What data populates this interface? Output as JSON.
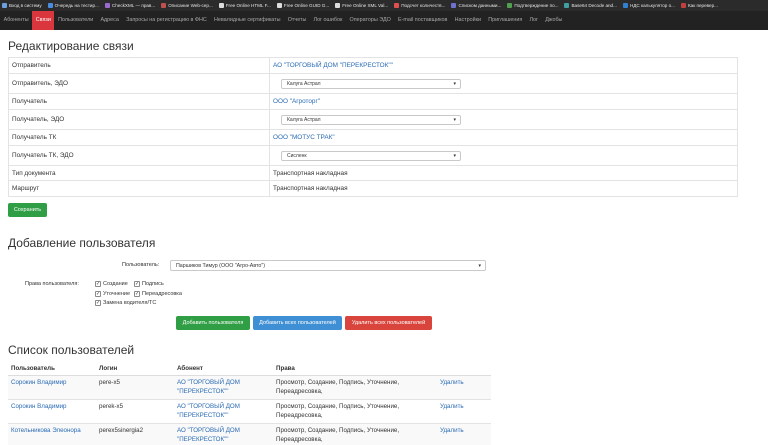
{
  "bookmarks": [
    {
      "label": "Вход в систему",
      "color": "#6aa0e0"
    },
    {
      "label": "Очередь на тестир...",
      "color": "#4a8de0"
    },
    {
      "label": "CheckXML — прав...",
      "color": "#9a6ad0"
    },
    {
      "label": "Описание Web-сер...",
      "color": "#c05050"
    },
    {
      "label": "Free Online HTML F...",
      "color": "#dddddd"
    },
    {
      "label": "Free Online GUID G...",
      "color": "#dddddd"
    },
    {
      "label": "Free Online XML Val...",
      "color": "#dddddd"
    },
    {
      "label": "Подсчет количеств...",
      "color": "#e05050"
    },
    {
      "label": "Списком данными...",
      "color": "#7070d0"
    },
    {
      "label": "Подтверждение по...",
      "color": "#50a050"
    },
    {
      "label": "Base64 Decode and...",
      "color": "#40a0a0"
    },
    {
      "label": "НДС калькулятор о...",
      "color": "#3080d0"
    },
    {
      "label": "Как перевер...",
      "color": "#c04040"
    }
  ],
  "nav": {
    "items": [
      "Абоненты",
      "Связи",
      "Пользователи",
      "Адреса",
      "Запросы на регистрацию в ФНС",
      "Невалидные сертификаты",
      "Отчеты",
      "Лог ошибок",
      "Операторы ЭДО",
      "E-mail поставщиков",
      "Настройки",
      "Приглашения",
      "Лог",
      "Джобы"
    ],
    "active_index": 1
  },
  "edit": {
    "title": "Редактирование связи",
    "rows": [
      {
        "label": "Отправитель",
        "type": "link",
        "value": "АО \"ТОРГОВЫЙ ДОМ \"ПЕРЕКРЕСТОК\"\""
      },
      {
        "label": "Отправитель, ЭДО",
        "type": "select",
        "value": "Калуга Астрал"
      },
      {
        "label": "Получатель",
        "type": "link",
        "value": "ООО \"Агроторг\""
      },
      {
        "label": "Получатель, ЭДО",
        "type": "select",
        "value": "Калуга Астрал"
      },
      {
        "label": "Получатель ТК",
        "type": "link",
        "value": "ООО \"МОТУС ТРАК\""
      },
      {
        "label": "Получатель ТК, ЭДО",
        "type": "select",
        "value": "Сисленк"
      },
      {
        "label": "Тип документа",
        "type": "text",
        "value": "Транспортная накладная"
      },
      {
        "label": "Маршрут",
        "type": "text",
        "value": "Транспортная накладная"
      }
    ],
    "save_label": "Сохранить"
  },
  "add_user": {
    "title": "Добавление пользователя",
    "user_label": "Пользователь:",
    "user_value": "Паршиков Тимур (ООО \"Агро-Авто\")",
    "rights_label": "Права пользователя:",
    "rights": [
      {
        "label": "Создание",
        "checked": true
      },
      {
        "label": "Подпись",
        "checked": true
      },
      {
        "label": "Уточнение",
        "checked": true
      },
      {
        "label": "Переадресовка",
        "checked": true
      },
      {
        "label": "Замена водителя/ТС",
        "checked": true
      }
    ],
    "add_button": "Добавить пользователя",
    "add_all_button": "Добавить всех пользователей",
    "delete_all_button": "Удалить всех пользователей"
  },
  "user_list": {
    "title": "Список пользователей",
    "columns": [
      "Пользователь",
      "Логин",
      "Абонент",
      "Права",
      ""
    ],
    "rows": [
      {
        "user": "Сорокин Владимир",
        "login": "pere-x5",
        "subscriber": "АО \"ТОРГОВЫЙ ДОМ \"ПЕРЕКРЕСТОК\"\"",
        "rights": "Просмотр, Создание, Подпись, Уточнение, Переадресовка,",
        "action": "Удалить"
      },
      {
        "user": "Сорокин Владимир",
        "login": "perek-x5",
        "subscriber": "АО \"ТОРГОВЫЙ ДОМ \"ПЕРЕКРЕСТОК\"\"",
        "rights": "Просмотр, Создание, Подпись, Уточнение, Переадресовка,",
        "action": "Удалить"
      },
      {
        "user": "Котельникова Элеонора",
        "login": "perex5sinergia2",
        "subscriber": "АО \"ТОРГОВЫЙ ДОМ \"ПЕРЕКРЕСТОК\"\"",
        "rights": "Просмотр, Создание, Подпись, Уточнение, Переадресовка,",
        "action": "Удалить"
      }
    ]
  }
}
